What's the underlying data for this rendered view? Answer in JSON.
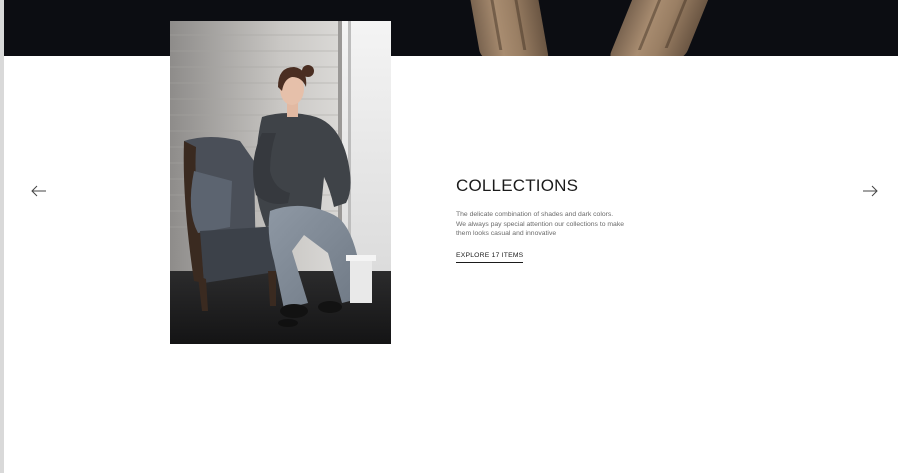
{
  "slider": {
    "prev_icon": "arrow-left-icon",
    "next_icon": "arrow-right-icon"
  },
  "collection": {
    "title": "COLLECTIONS",
    "description_lines": [
      "The delicate combination of shades and dark colors.",
      "We always pay special attention our collections to make",
      "them looks casual and innovative"
    ],
    "cta_label": "EXPLORE 17 ITEMS"
  },
  "colors": {
    "banner_background": "#0c0d12",
    "text_primary": "#1b1b1b",
    "text_secondary": "#6b6b6b",
    "page_background": "#ffffff"
  }
}
